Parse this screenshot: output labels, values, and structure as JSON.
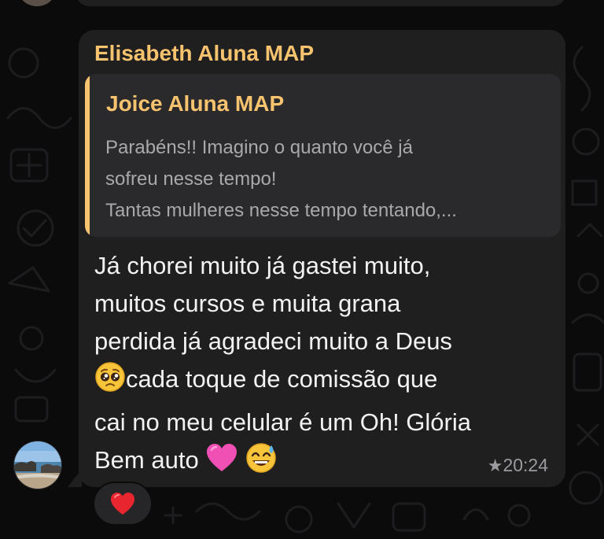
{
  "chat": {
    "bubble": {
      "sender_name": "Elisabeth Aluna MAP",
      "quoted": {
        "author": "Joice Aluna MAP",
        "lines": [
          "Parabéns!! Imagino o quanto você já",
          "sofreu nesse tempo!",
          "Tantas mulheres nesse tempo tentando,..."
        ]
      },
      "message_lines": [
        "Já chorei muito já gastei muito,",
        "muitos  cursos e muita grana",
        "perdida já agradeci muito a Deus",
        "cada toque de comissão que",
        "cai no meu celular é um Oh! Glória",
        "Bem auto"
      ],
      "emojis": [
        "pleading-face",
        "pink-heart",
        "grinning-sweat-face"
      ],
      "starred": true,
      "star_glyph": "★",
      "time": "20:24"
    },
    "reaction": {
      "emoji": "red-heart"
    }
  },
  "colors": {
    "background": "#0b0b0c",
    "bubble": "#1f1f20",
    "quote_background": "#2a2a2c",
    "sender_accent": "#f7c36f",
    "message_text": "#f2f2f2",
    "quote_text": "#a9a9ac",
    "timestamp": "#9b9b9f"
  }
}
